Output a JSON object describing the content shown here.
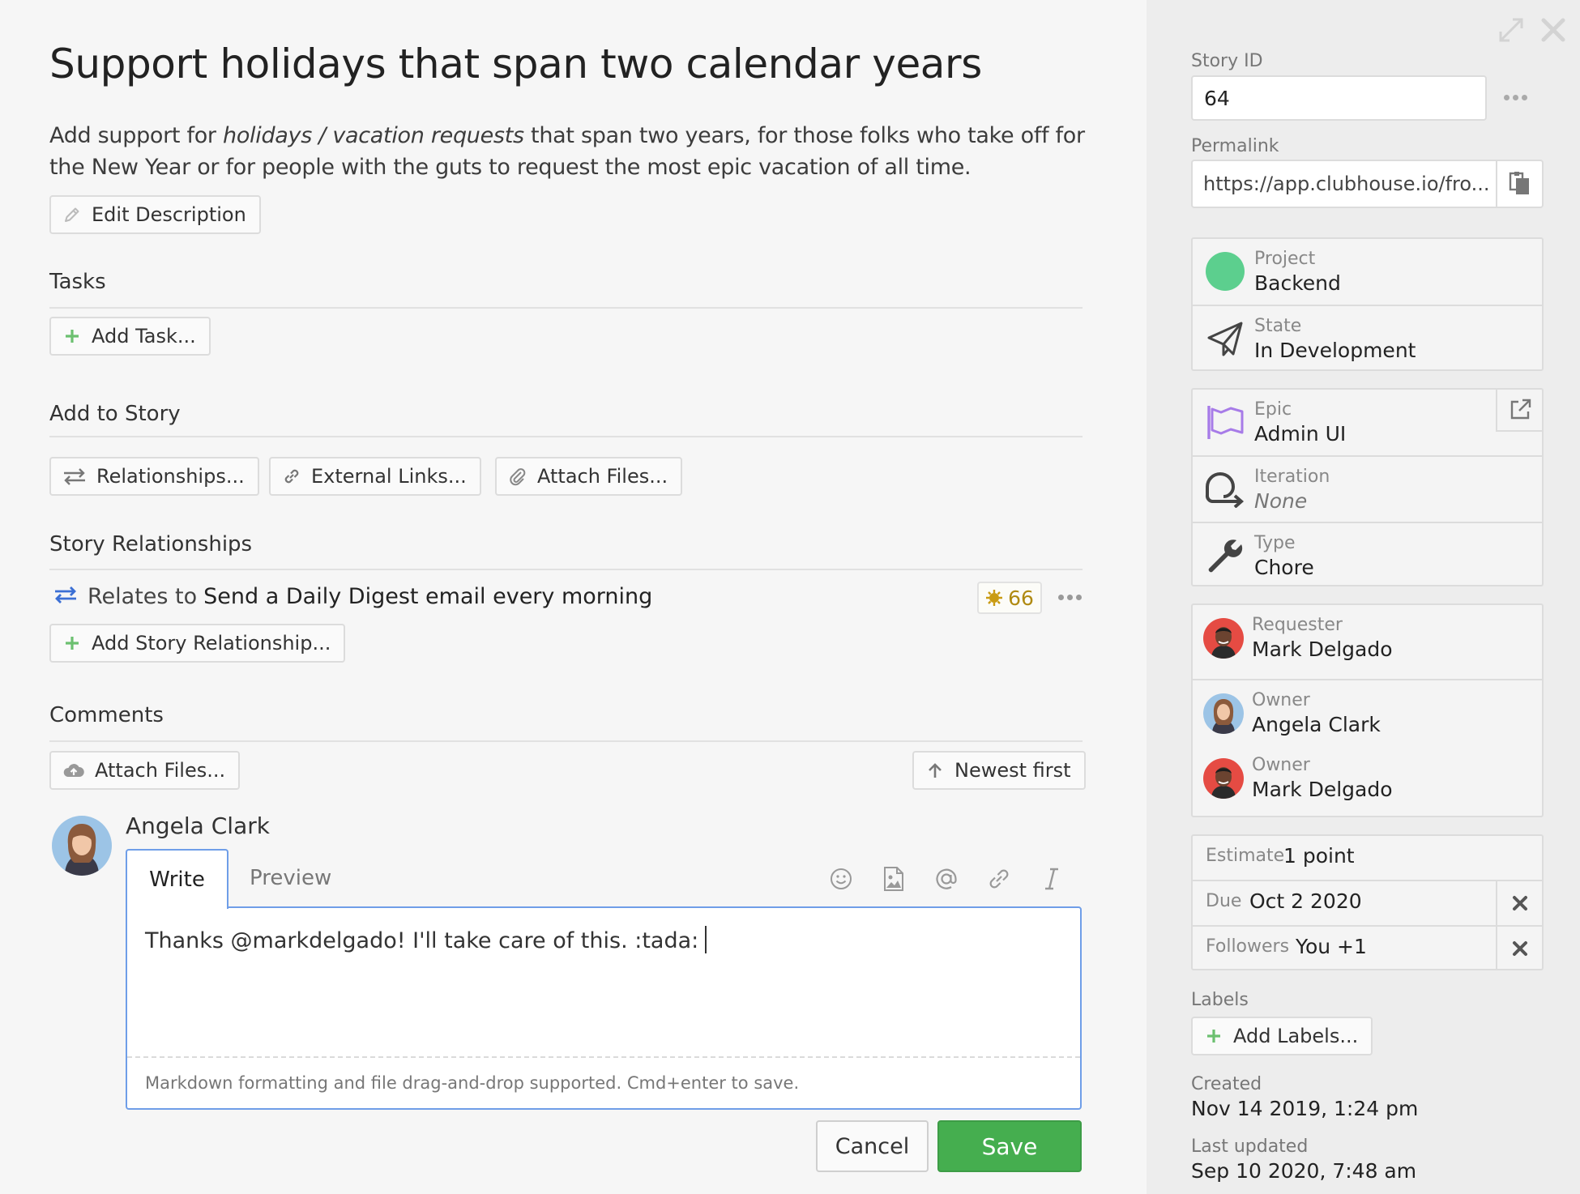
{
  "story": {
    "title": "Support holidays that span two calendar years",
    "description": {
      "before": "Add support for ",
      "emphasis": "holidays / vacation requests",
      "after": " that span two years, for those folks who take off for the New Year or for people with the guts to request the most epic vacation of all time."
    },
    "edit_description_label": "Edit Description"
  },
  "tasks": {
    "heading": "Tasks",
    "add_label": "Add Task..."
  },
  "add_to_story": {
    "heading": "Add to Story",
    "relationships_label": "Relationships...",
    "external_links_label": "External Links...",
    "attach_files_label": "Attach Files..."
  },
  "story_relationships": {
    "heading": "Story Relationships",
    "items": [
      {
        "type": "Relates to",
        "story_name": "Send a Daily Digest email every morning",
        "story_id": "66"
      }
    ],
    "add_label": "Add Story Relationship..."
  },
  "comments": {
    "heading": "Comments",
    "attach_label": "Attach Files...",
    "sort_label": "Newest first",
    "composer": {
      "author": "Angela Clark",
      "tab_write": "Write",
      "tab_preview": "Preview",
      "text": "Thanks @markdelgado! I'll take care of this. :tada:",
      "hint": "Markdown formatting and file drag-and-drop supported. Cmd+enter to save.",
      "cancel_label": "Cancel",
      "save_label": "Save"
    }
  },
  "sidebar": {
    "story_id_label": "Story ID",
    "story_id": "64",
    "permalink_label": "Permalink",
    "permalink": "https://app.clubhouse.io/fro...",
    "project": {
      "label": "Project",
      "value": "Backend",
      "color": "#5ccf8e"
    },
    "state": {
      "label": "State",
      "value": "In Development"
    },
    "epic": {
      "label": "Epic",
      "value": "Admin UI"
    },
    "iteration": {
      "label": "Iteration",
      "value": "None"
    },
    "type": {
      "label": "Type",
      "value": "Chore"
    },
    "requester": {
      "label": "Requester",
      "value": "Mark Delgado"
    },
    "owners": [
      {
        "label": "Owner",
        "value": "Angela Clark"
      },
      {
        "label": "Owner",
        "value": "Mark Delgado"
      }
    ],
    "estimate": {
      "label": "Estimate",
      "value": "1 point"
    },
    "due": {
      "label": "Due",
      "value": "Oct 2 2020"
    },
    "followers": {
      "label": "Followers",
      "value": "You +1"
    },
    "labels_heading": "Labels",
    "add_labels_label": "Add Labels...",
    "created_label": "Created",
    "created": "Nov 14 2019, 1:24 pm",
    "updated_label": "Last updated",
    "updated": "Sep 10 2020, 7:48 am"
  },
  "colors": {
    "accent_blue": "#6f9ee8",
    "save_green": "#45ae4f",
    "plus_green": "#6cc070",
    "epic_purple": "#a77be8",
    "badge_gold": "#c99b13"
  }
}
